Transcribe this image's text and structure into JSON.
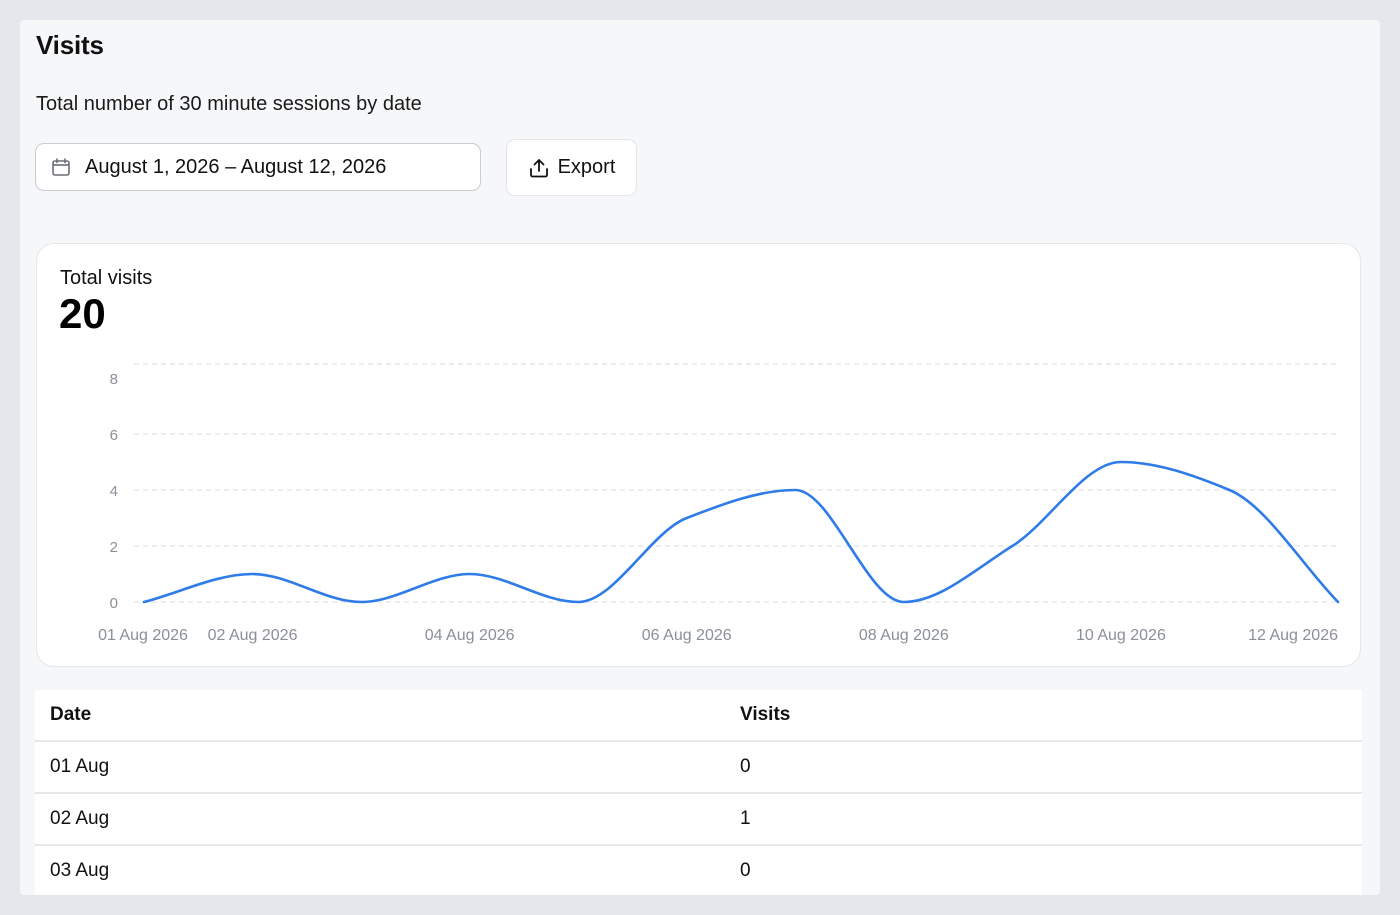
{
  "page": {
    "title": "Visits",
    "subtitle": "Total number of 30 minute sessions by date"
  },
  "toolbar": {
    "date_range": "August 1, 2026 – August 12, 2026",
    "calendar_icon": "calendar-icon",
    "export_label": "Export",
    "export_icon": "upload-icon"
  },
  "summary": {
    "label": "Total visits",
    "value": "20"
  },
  "colors": {
    "accent": "#2f7be8",
    "gridline": "#d9dbde",
    "tick_text": "#8a8f98"
  },
  "chart_data": {
    "type": "line",
    "x": [
      "01 Aug 2026",
      "02 Aug 2026",
      "03 Aug 2026",
      "04 Aug 2026",
      "05 Aug 2026",
      "06 Aug 2026",
      "07 Aug 2026",
      "08 Aug 2026",
      "09 Aug 2026",
      "10 Aug 2026",
      "11 Aug 2026",
      "12 Aug 2026"
    ],
    "series": [
      {
        "values": [
          0,
          1,
          0,
          1,
          0,
          3,
          4,
          0,
          2,
          5,
          4,
          0
        ]
      }
    ],
    "x_tick_labels": [
      "01 Aug 2026",
      "02 Aug 2026",
      "04 Aug 2026",
      "06 Aug 2026",
      "08 Aug 2026",
      "10 Aug 2026",
      "12 Aug 2026"
    ],
    "y_ticks": [
      0,
      2,
      4,
      6,
      8
    ],
    "ylim": [
      0,
      8
    ],
    "grid": true,
    "curve": "smooth"
  },
  "table": {
    "headers": {
      "date": "Date",
      "visits": "Visits"
    },
    "rows": [
      {
        "date": "01 Aug",
        "visits": "0"
      },
      {
        "date": "02 Aug",
        "visits": "1"
      },
      {
        "date": "03 Aug",
        "visits": "0"
      }
    ]
  }
}
